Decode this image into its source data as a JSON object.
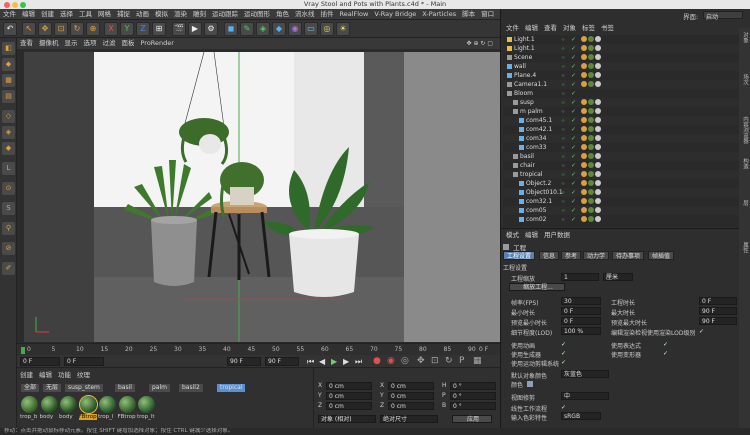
{
  "window": {
    "title": "Vray Stool and Pots with Plants.c4d * - Main"
  },
  "menubar": [
    "文件",
    "编辑",
    "创建",
    "选择",
    "工具",
    "网格",
    "捕捉",
    "动画",
    "模拟",
    "渲染",
    "雕刻",
    "运动跟踪",
    "运动图形",
    "角色",
    "流水线",
    "插件",
    "RealFlow",
    "V-Ray Bridge",
    "X-Particles",
    "脚本",
    "窗口",
    "帮助"
  ],
  "layout_label": "界面:",
  "layout_value": "启动",
  "viewport_menu": [
    "查看",
    "摄像机",
    "显示",
    "选项",
    "过滤",
    "面板",
    "ProRender"
  ],
  "timeline": {
    "ticks": [
      "0",
      "5",
      "10",
      "15",
      "20",
      "25",
      "30",
      "35",
      "40",
      "45",
      "50",
      "55",
      "60",
      "65",
      "70",
      "75",
      "80",
      "85",
      "90"
    ],
    "frame_right": "0 F",
    "current": "0 F",
    "start": "0 F",
    "end": "90 F",
    "end2": "90 F"
  },
  "material_menu": [
    "创建",
    "编辑",
    "功能",
    "纹理"
  ],
  "material_filters": [
    {
      "label": "全部",
      "color": "#4a4a4a"
    },
    {
      "label": "无层",
      "color": "#4a4a4a"
    },
    {
      "label": "susp_stem",
      "color": "#4a4a4a"
    },
    {
      "label": "basil",
      "color": "#4a4a4a"
    },
    {
      "label": "palm",
      "color": "#4a4a4a"
    },
    {
      "label": "basil2",
      "color": "#4a4a4a"
    },
    {
      "label": "tropical",
      "color": "#5a8fd0"
    }
  ],
  "materials": [
    {
      "label": "trop_b",
      "color": "#3f6b2f"
    },
    {
      "label": "body",
      "color": "#2e5a2a"
    },
    {
      "label": "body",
      "color": "#2b5726"
    },
    {
      "label": "FBtrop",
      "color": "#355f2c"
    },
    {
      "label": "trop_l",
      "color": "#2f6030"
    },
    {
      "label": "FBtrop",
      "color": "#3a6530"
    },
    {
      "label": "trop_lt",
      "color": "#316234"
    }
  ],
  "coords": {
    "rows": [
      {
        "axis": "X",
        "pos": "0 cm",
        "axis2": "X",
        "size": "0 cm",
        "axis3": "H",
        "rot": "0 °"
      },
      {
        "axis": "Y",
        "pos": "0 cm",
        "axis2": "Y",
        "size": "0 cm",
        "axis3": "P",
        "rot": "0 °"
      },
      {
        "axis": "Z",
        "pos": "0 cm",
        "axis2": "Z",
        "size": "0 cm",
        "axis3": "B",
        "rot": "0 °"
      }
    ],
    "mode": "对象 (相对)",
    "size_mode": "绝对尺寸",
    "apply": "应用"
  },
  "statusbar": "移动：点击并拖动鼠标移动元素。按住 SHIFT 键增加选择对象；按住 CTRL 键减少选择对象。",
  "object_manager": {
    "menu": [
      "文件",
      "编辑",
      "查看",
      "对象",
      "标签",
      "书签"
    ],
    "rows": [
      {
        "name": "Light.1",
        "indent": 0,
        "icon": "#e8c040"
      },
      {
        "name": "Light.1",
        "indent": 0,
        "icon": "#e8c040"
      },
      {
        "name": "Scene",
        "indent": 0,
        "icon": "#9a9a9a"
      },
      {
        "name": "wall",
        "indent": 0,
        "icon": "#6ab0e8"
      },
      {
        "name": "Plane.4",
        "indent": 0,
        "icon": "#6ab0e8"
      },
      {
        "name": "Camera1.1",
        "indent": 0,
        "icon": "#9a9a9a"
      },
      {
        "name": "Bloom",
        "indent": 0,
        "icon": "#9a9a9a"
      },
      {
        "name": "susp",
        "indent": 1,
        "icon": "#9a9a9a"
      },
      {
        "name": "m palm",
        "indent": 1,
        "icon": "#9a9a9a"
      },
      {
        "name": "com45.1",
        "indent": 2,
        "icon": "#6ab0e8"
      },
      {
        "name": "com42.1",
        "indent": 2,
        "icon": "#6ab0e8"
      },
      {
        "name": "com34",
        "indent": 2,
        "icon": "#6ab0e8"
      },
      {
        "name": "com33",
        "indent": 2,
        "icon": "#6ab0e8"
      },
      {
        "name": "basil",
        "indent": 1,
        "icon": "#9a9a9a"
      },
      {
        "name": "chair",
        "indent": 1,
        "icon": "#9a9a9a"
      },
      {
        "name": "tropical",
        "indent": 1,
        "icon": "#9a9a9a"
      },
      {
        "name": "Object.2",
        "indent": 2,
        "icon": "#6ab0e8"
      },
      {
        "name": "Object010.1",
        "indent": 2,
        "icon": "#6ab0e8"
      },
      {
        "name": "com32.1",
        "indent": 2,
        "icon": "#6ab0e8"
      },
      {
        "name": "com05",
        "indent": 2,
        "icon": "#6ab0e8"
      },
      {
        "name": "com02",
        "indent": 2,
        "icon": "#6ab0e8"
      }
    ]
  },
  "attributes": {
    "menu": [
      "模式",
      "编辑",
      "用户数据"
    ],
    "title": "工程",
    "tabs": [
      "工程设置",
      "信息",
      "参考",
      "动力学",
      "待办事项",
      "帧插值"
    ],
    "section": "工程设置",
    "scale_label": "工程缩放",
    "scale_value": "1",
    "scale_unit": "厘米",
    "scale_button": "缩放工程...",
    "fields": [
      {
        "l": "帧率(FPS)",
        "v": "30",
        "l2": "工程时长",
        "v2": "0 F"
      },
      {
        "l": "最小时长",
        "v": "0 F",
        "l2": "最大时长",
        "v2": "90 F"
      },
      {
        "l": "预览最小时长",
        "v": "0 F",
        "l2": "预览最大时长",
        "v2": "90 F"
      },
      {
        "l": "细节程度(LOD)",
        "v": "100 %",
        "l2": "编辑渲染检视使用渲染LOD级别",
        "v2": ""
      }
    ],
    "checks": [
      {
        "l": "使用动画",
        "l2": "使用表达式"
      },
      {
        "l": "使用生成器",
        "l2": "使用变形器"
      },
      {
        "l": "使用运动剪辑系统",
        "l2": ""
      }
    ],
    "default_color_label": "默认对象颜色",
    "default_color_value": "灰蓝色",
    "color_label": "颜色",
    "view_clip_label": "视图修剪",
    "view_clip_value": "中",
    "linear_label": "线性工作流程",
    "input_color_label": "输入色彩特性",
    "input_color_value": "sRGB"
  },
  "side_tabs": [
    "对象",
    "场次",
    "内容浏览器",
    "构造",
    "层",
    "属性"
  ]
}
